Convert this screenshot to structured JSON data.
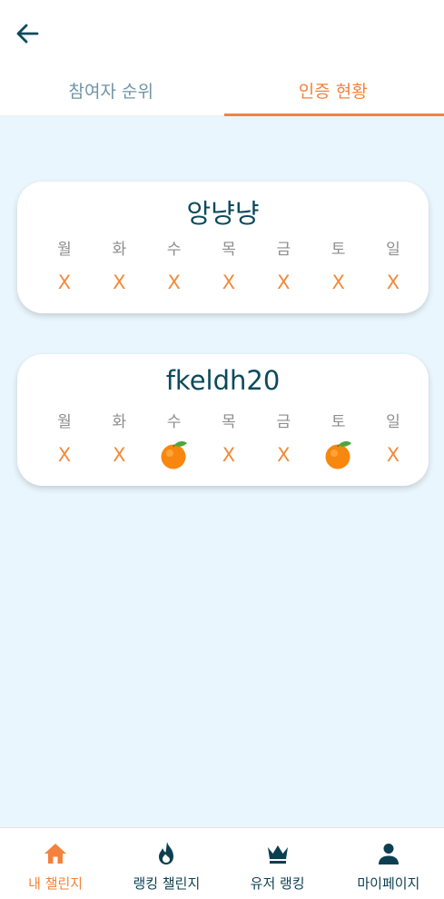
{
  "colors": {
    "accent": "#f4823c",
    "primary": "#0c4a5c",
    "background": "#eaf6fd"
  },
  "header": {
    "back_icon": "arrow-left-icon"
  },
  "tabs": [
    {
      "label": "참여자 순위",
      "active": false
    },
    {
      "label": "인증 현황",
      "active": true
    }
  ],
  "cards": [
    {
      "name": "앙냥냥",
      "days": [
        "월",
        "화",
        "수",
        "목",
        "금",
        "토",
        "일"
      ],
      "marks": [
        "X",
        "X",
        "X",
        "X",
        "X",
        "X",
        "X"
      ]
    },
    {
      "name": "fkeldh20",
      "days": [
        "월",
        "화",
        "수",
        "목",
        "금",
        "토",
        "일"
      ],
      "marks": [
        "X",
        "X",
        "orange-icon",
        "X",
        "X",
        "orange-icon",
        "X"
      ]
    }
  ],
  "bottom_nav": [
    {
      "label": "내 챌린지",
      "icon": "home-icon",
      "active": true
    },
    {
      "label": "랭킹 챌린지",
      "icon": "fire-icon",
      "active": false
    },
    {
      "label": "유저 랭킹",
      "icon": "crown-icon",
      "active": false
    },
    {
      "label": "마이페이지",
      "icon": "person-icon",
      "active": false
    }
  ]
}
